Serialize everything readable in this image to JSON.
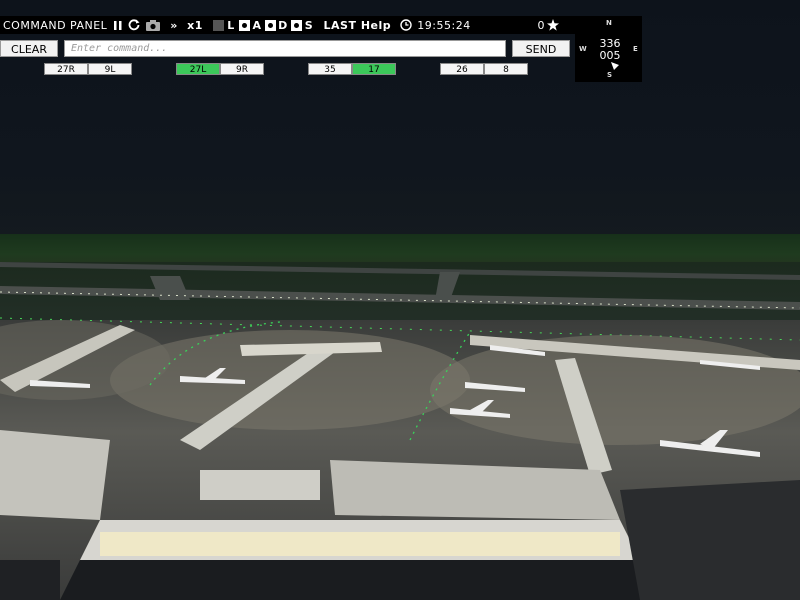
{
  "topbar": {
    "title": "COMMAND PANEL",
    "pause_icon": "pause-icon",
    "restart_icon": "restart-icon",
    "camera_icon": "camera-icon",
    "fastforward_icon": "fast-forward-icon",
    "speed": "x1",
    "toggle_l": "L",
    "toggle_a": "A",
    "toggle_d": "D",
    "toggle_s": "S",
    "last": "LAST",
    "help": "Help",
    "clock_icon": "clock-icon",
    "time": "19:55:24",
    "score": "0",
    "star_icon": "star-icon"
  },
  "command": {
    "clear_label": "CLEAR",
    "placeholder": "Enter command...",
    "send_label": "SEND"
  },
  "runways": [
    {
      "label": "27R",
      "active": false
    },
    {
      "label": "9L",
      "active": false
    },
    {
      "label": "27L",
      "active": true
    },
    {
      "label": "9R",
      "active": false
    },
    {
      "label": "35",
      "active": false
    },
    {
      "label": "17",
      "active": true
    },
    {
      "label": "26",
      "active": false
    },
    {
      "label": "8",
      "active": false
    }
  ],
  "compass": {
    "n": "N",
    "s": "S",
    "e": "E",
    "w": "W",
    "heading_top": "336",
    "heading_bottom": "005"
  },
  "colors": {
    "runway_active": "#3cc85a",
    "bar_bg": "#000000"
  }
}
